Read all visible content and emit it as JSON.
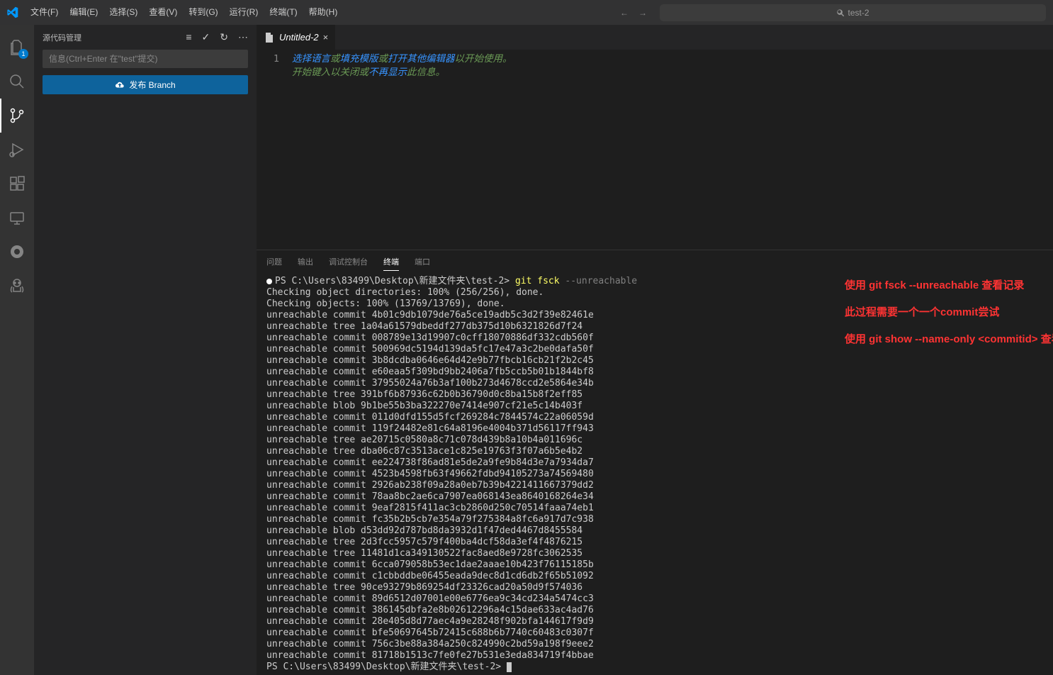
{
  "menu": [
    "文件(F)",
    "编辑(E)",
    "选择(S)",
    "查看(V)",
    "转到(G)",
    "运行(R)",
    "终端(T)",
    "帮助(H)"
  ],
  "search_text": "test-2",
  "explorer_badge": "1",
  "sidebar": {
    "title": "源代码管理",
    "commit_placeholder": "信息(Ctrl+Enter 在\"test\"提交)",
    "publish_label": "发布 Branch"
  },
  "tab": {
    "name": "Untitled-2"
  },
  "editor": {
    "line_num": "1",
    "l1_a": "选择语言",
    "l1_b": "或",
    "l1_c": "填充模版",
    "l1_d": "或",
    "l1_e": "打开其他编辑器",
    "l1_f": "以开始使用。",
    "l2_a": "开始键入以关闭或",
    "l2_b": "不再显示",
    "l2_c": "此信息。"
  },
  "panel_tabs": {
    "problems": "问题",
    "output": "输出",
    "debug": "调试控制台",
    "terminal": "终端",
    "ports": "端口"
  },
  "terminal": {
    "prompt1": "PS C:\\Users\\83499\\Desktop\\新建文件夹\\test-2>",
    "cmd": "git fsck",
    "flag": "--unreachable",
    "lines": [
      "Checking object directories: 100% (256/256), done.",
      "Checking objects: 100% (13769/13769), done.",
      "unreachable commit 4b01c9db1079de76a5ce19adb5c3d2f39e82461e",
      "unreachable tree 1a04a61579dbeddf277db375d10b6321826d7f24",
      "unreachable commit 008789e13d19907c0cff18070886df332cdb560f",
      "unreachable commit 500969dc5194d139da5fc17e47a3c2be0dafa50f",
      "unreachable commit 3b8dcdba0646e64d42e9b77fbcb16cb21f2b2c45",
      "unreachable commit e60eaa5f309bd9bb2406a7fb5ccb5b01b1844bf8",
      "unreachable commit 37955024a76b3af100b273d4678ccd2e5864e34b",
      "unreachable tree 391bf6b87936c62b0b36790d0c8ba15b8f2eff85",
      "unreachable blob 9b1be55b3ba322270e7414e907cf21e5c14b403f",
      "unreachable commit 011d0dfd155d5fcf269284c7844574c22a06059d",
      "unreachable commit 119f24482e81c64a8196e4004b371d56117ff943",
      "unreachable tree ae20715c0580a8c71c078d439b8a10b4a011696c",
      "unreachable tree dba06c87c3513ace1c825e19763f3f07a6b5e4b2",
      "unreachable commit ee224738f86ad81e5de2a9fe9b84d3e7a7934da7",
      "unreachable commit 4523b4598fb63f49662fdbd94105273a74569480",
      "unreachable commit 2926ab238f09a28a0eb7b39b4221411667379dd2",
      "unreachable commit 78aa8bc2ae6ca7907ea068143ea8640168264e34",
      "unreachable commit 9eaf2815f411ac3cb2860d250c70514faaa74eb1",
      "unreachable commit fc35b2b5cb7e354a79f275384a8fc6a917d7c938",
      "unreachable blob d53dd92d787bd8da3932d1f47ded4467d8455584",
      "unreachable tree 2d3fcc5957c579f400ba4dcf58da3ef4f4876215",
      "unreachable tree 11481d1ca349130522fac8aed8e9728fc3062535",
      "unreachable commit 6cca079058b53ec1dae2aaae10b423f76115185b",
      "unreachable commit c1cbbddbe06455eada9dec8d1cd6db2f65b51092",
      "unreachable tree 90ce93279b869254df23326cad20a50d9f574036",
      "unreachable commit 89d6512d07001e00e6776ea9c34cd234a5474cc3",
      "unreachable commit 386145dbfa2e8b02612296a4c15dae633ac4ad76",
      "unreachable commit 28e405d8d77aec4a9e28248f902bfa144617f9d9",
      "unreachable commit bfe50697645b72415c688b6b7740c60483c0307f",
      "unreachable commit 756c3be88a384a250c824990c2bd59a198f9eee2",
      "unreachable commit 81718b1513c7fe0fe27b531e3eda834719f4bbae"
    ],
    "prompt2": "PS C:\\Users\\83499\\Desktop\\新建文件夹\\test-2>"
  },
  "annotations": {
    "a1": "使用 git fsck --unreachable 查看记录",
    "a2": "此过程需要一个一个commit尝试",
    "a3": "使用 git show --name-only <commitid> 查看特征"
  }
}
